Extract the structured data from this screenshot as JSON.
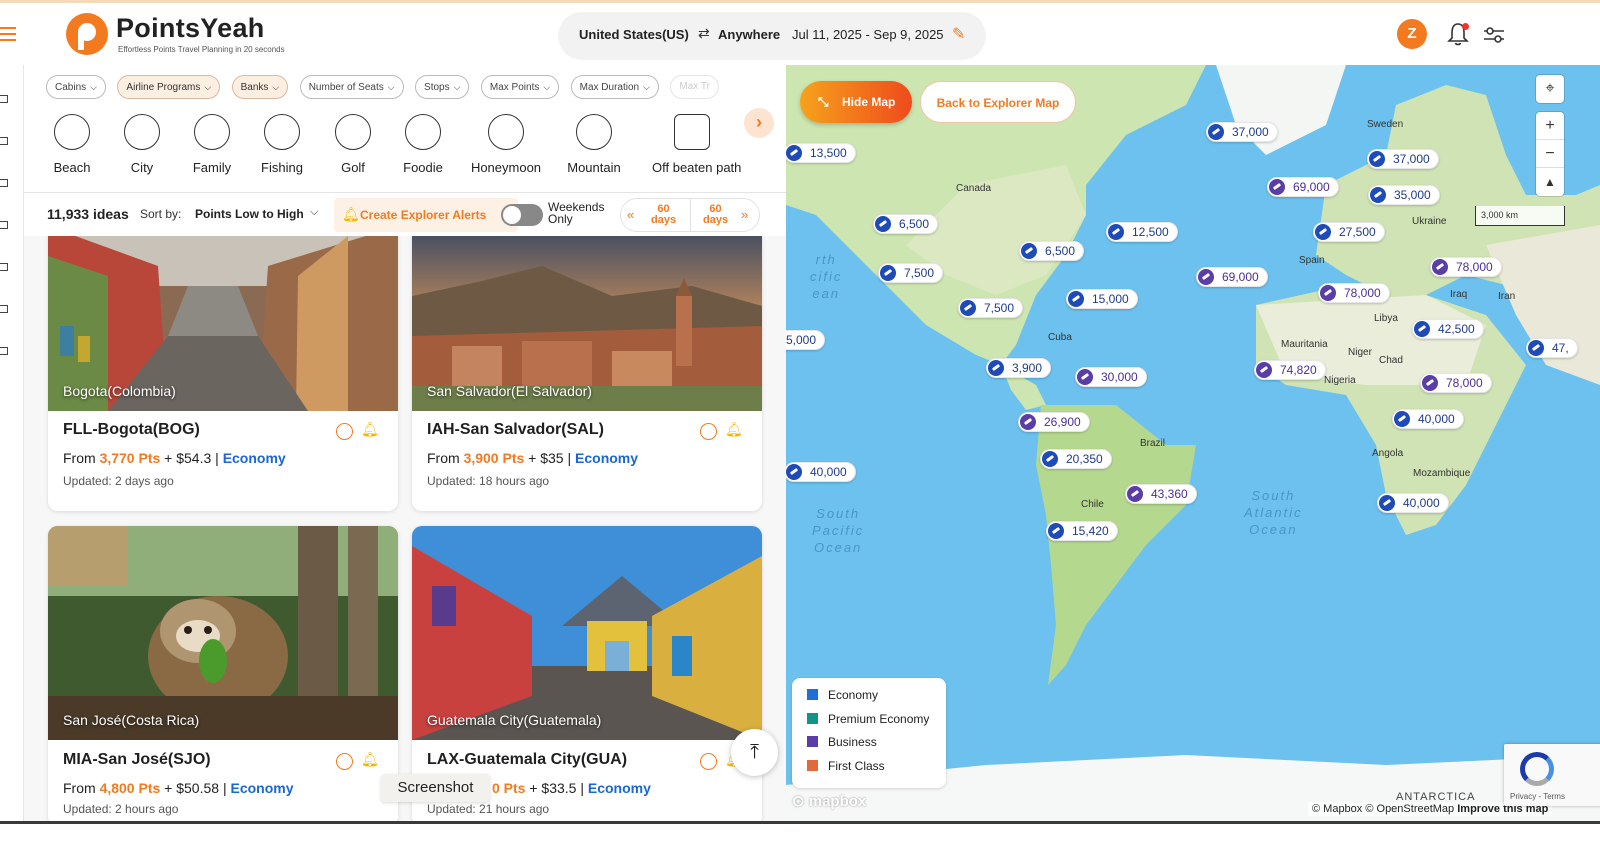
{
  "header": {
    "brand": "PointsYeah",
    "tagline": "Effortless Points Travel Planning in 20 seconds",
    "origin": "United States(US)",
    "destination": "Anywhere",
    "dates": "Jul 11, 2025 - Sep 9, 2025",
    "avatar_letter": "Z"
  },
  "filters": [
    {
      "label": "Cabins",
      "active": false
    },
    {
      "label": "Airline Programs",
      "active": true
    },
    {
      "label": "Banks",
      "active": true
    },
    {
      "label": "Number of Seats",
      "active": false
    },
    {
      "label": "Stops",
      "active": false
    },
    {
      "label": "Max Points",
      "active": false
    },
    {
      "label": "Max Duration",
      "active": false
    },
    {
      "label": "Max Tr",
      "active": false
    }
  ],
  "categories": [
    "Beach",
    "City",
    "Family",
    "Fishing",
    "Golf",
    "Foodie",
    "Honeymoon",
    "Mountain",
    "Off beaten path"
  ],
  "sortbar": {
    "count": "11,933 ideas",
    "sort_label": "Sort by:",
    "sort_value": "Points Low to High",
    "alerts": "Create Explorer Alerts",
    "weekends_line1": "Weekends",
    "weekends_line2": "Only",
    "range_from_num": "60",
    "range_from_unit": "days",
    "range_to_num": "60",
    "range_to_unit": "days"
  },
  "cards": [
    {
      "place": "Bogota(Colombia)",
      "route": "FLL-Bogota(BOG)",
      "from": "From ",
      "points": "3,770 Pts",
      "cash": " + $54.3 | ",
      "cabin": "Economy",
      "updated": "Updated: 2 days ago"
    },
    {
      "place": "San Salvador(El Salvador)",
      "route": "IAH-San Salvador(SAL)",
      "from": "From ",
      "points": "3,900 Pts",
      "cash": " + $35 | ",
      "cabin": "Economy",
      "updated": "Updated: 18 hours ago"
    },
    {
      "place": "San José(Costa Rica)",
      "route": "MIA-San José(SJO)",
      "from": "From ",
      "points": "4,800 Pts",
      "cash": " + $50.58 | ",
      "cabin": "Economy",
      "updated": "Updated: 2 hours ago"
    },
    {
      "place": "Guatemala City(Guatemala)",
      "route": "LAX-Guatemala City(GUA)",
      "from": "",
      "points": "0 Pts",
      "cash": " + $33.5 | ",
      "cabin": "Economy",
      "updated": "Updated: 21 hours ago"
    }
  ],
  "tooltip": "Screenshot",
  "map": {
    "hide_map": "Hide Map",
    "back_map": "Back to Explorer Map",
    "scale": "3,000 km",
    "legend": [
      {
        "label": "Economy",
        "color": "#1f6fd9"
      },
      {
        "label": "Premium Economy",
        "color": "#10948a"
      },
      {
        "label": "Business",
        "color": "#5b3da8"
      },
      {
        "label": "First Class",
        "color": "#e2693e"
      }
    ],
    "labels": [
      "Canada",
      "Cuba",
      "Brazil",
      "Chile",
      "Sweden",
      "Ukraine",
      "Spain",
      "Iraq",
      "Iran",
      "Libya",
      "Mauritania",
      "Niger",
      "Chad",
      "Nigeria",
      "Angola",
      "Mozambique"
    ],
    "ocean_south_pacific": "South\nPacific\nOcean",
    "ocean_south_atlantic": "South\nAtlantic\nOcean",
    "ocean_north_pacific": "rth\ncific\nean",
    "antarctica": "ANTARCTICA",
    "attribution_a": "© Mapbox © OpenStreetMap ",
    "attribution_b": "Improve this map",
    "mapbox": "mapbox",
    "recaptcha": "Privacy - Terms",
    "markers": [
      {
        "label": "13,500",
        "kind": "economy"
      },
      {
        "label": "37,000",
        "kind": "economy"
      },
      {
        "label": "37,000",
        "kind": "economy"
      },
      {
        "label": "69,000",
        "kind": "business"
      },
      {
        "label": "35,000",
        "kind": "economy"
      },
      {
        "label": "6,500",
        "kind": "economy"
      },
      {
        "label": "6,500",
        "kind": "economy"
      },
      {
        "label": "12,500",
        "kind": "economy"
      },
      {
        "label": "27,500",
        "kind": "economy"
      },
      {
        "label": "7,500",
        "kind": "economy"
      },
      {
        "label": "69,000",
        "kind": "business"
      },
      {
        "label": "78,000",
        "kind": "business"
      },
      {
        "label": "7,500",
        "kind": "economy"
      },
      {
        "label": "15,000",
        "kind": "economy"
      },
      {
        "label": "78,000",
        "kind": "business"
      },
      {
        "label": "42,500",
        "kind": "economy"
      },
      {
        "label": "5,000",
        "kind": "economy"
      },
      {
        "label": "3,900",
        "kind": "economy"
      },
      {
        "label": "30,000",
        "kind": "business"
      },
      {
        "label": "74,820",
        "kind": "business"
      },
      {
        "label": "78,000",
        "kind": "business"
      },
      {
        "label": "26,900",
        "kind": "business"
      },
      {
        "label": "40,000",
        "kind": "economy"
      },
      {
        "label": "20,350",
        "kind": "economy"
      },
      {
        "label": "40,000",
        "kind": "economy"
      },
      {
        "label": "43,360",
        "kind": "business"
      },
      {
        "label": "40,000",
        "kind": "economy"
      },
      {
        "label": "15,420",
        "kind": "economy"
      },
      {
        "label": "47,",
        "kind": "economy"
      }
    ]
  }
}
